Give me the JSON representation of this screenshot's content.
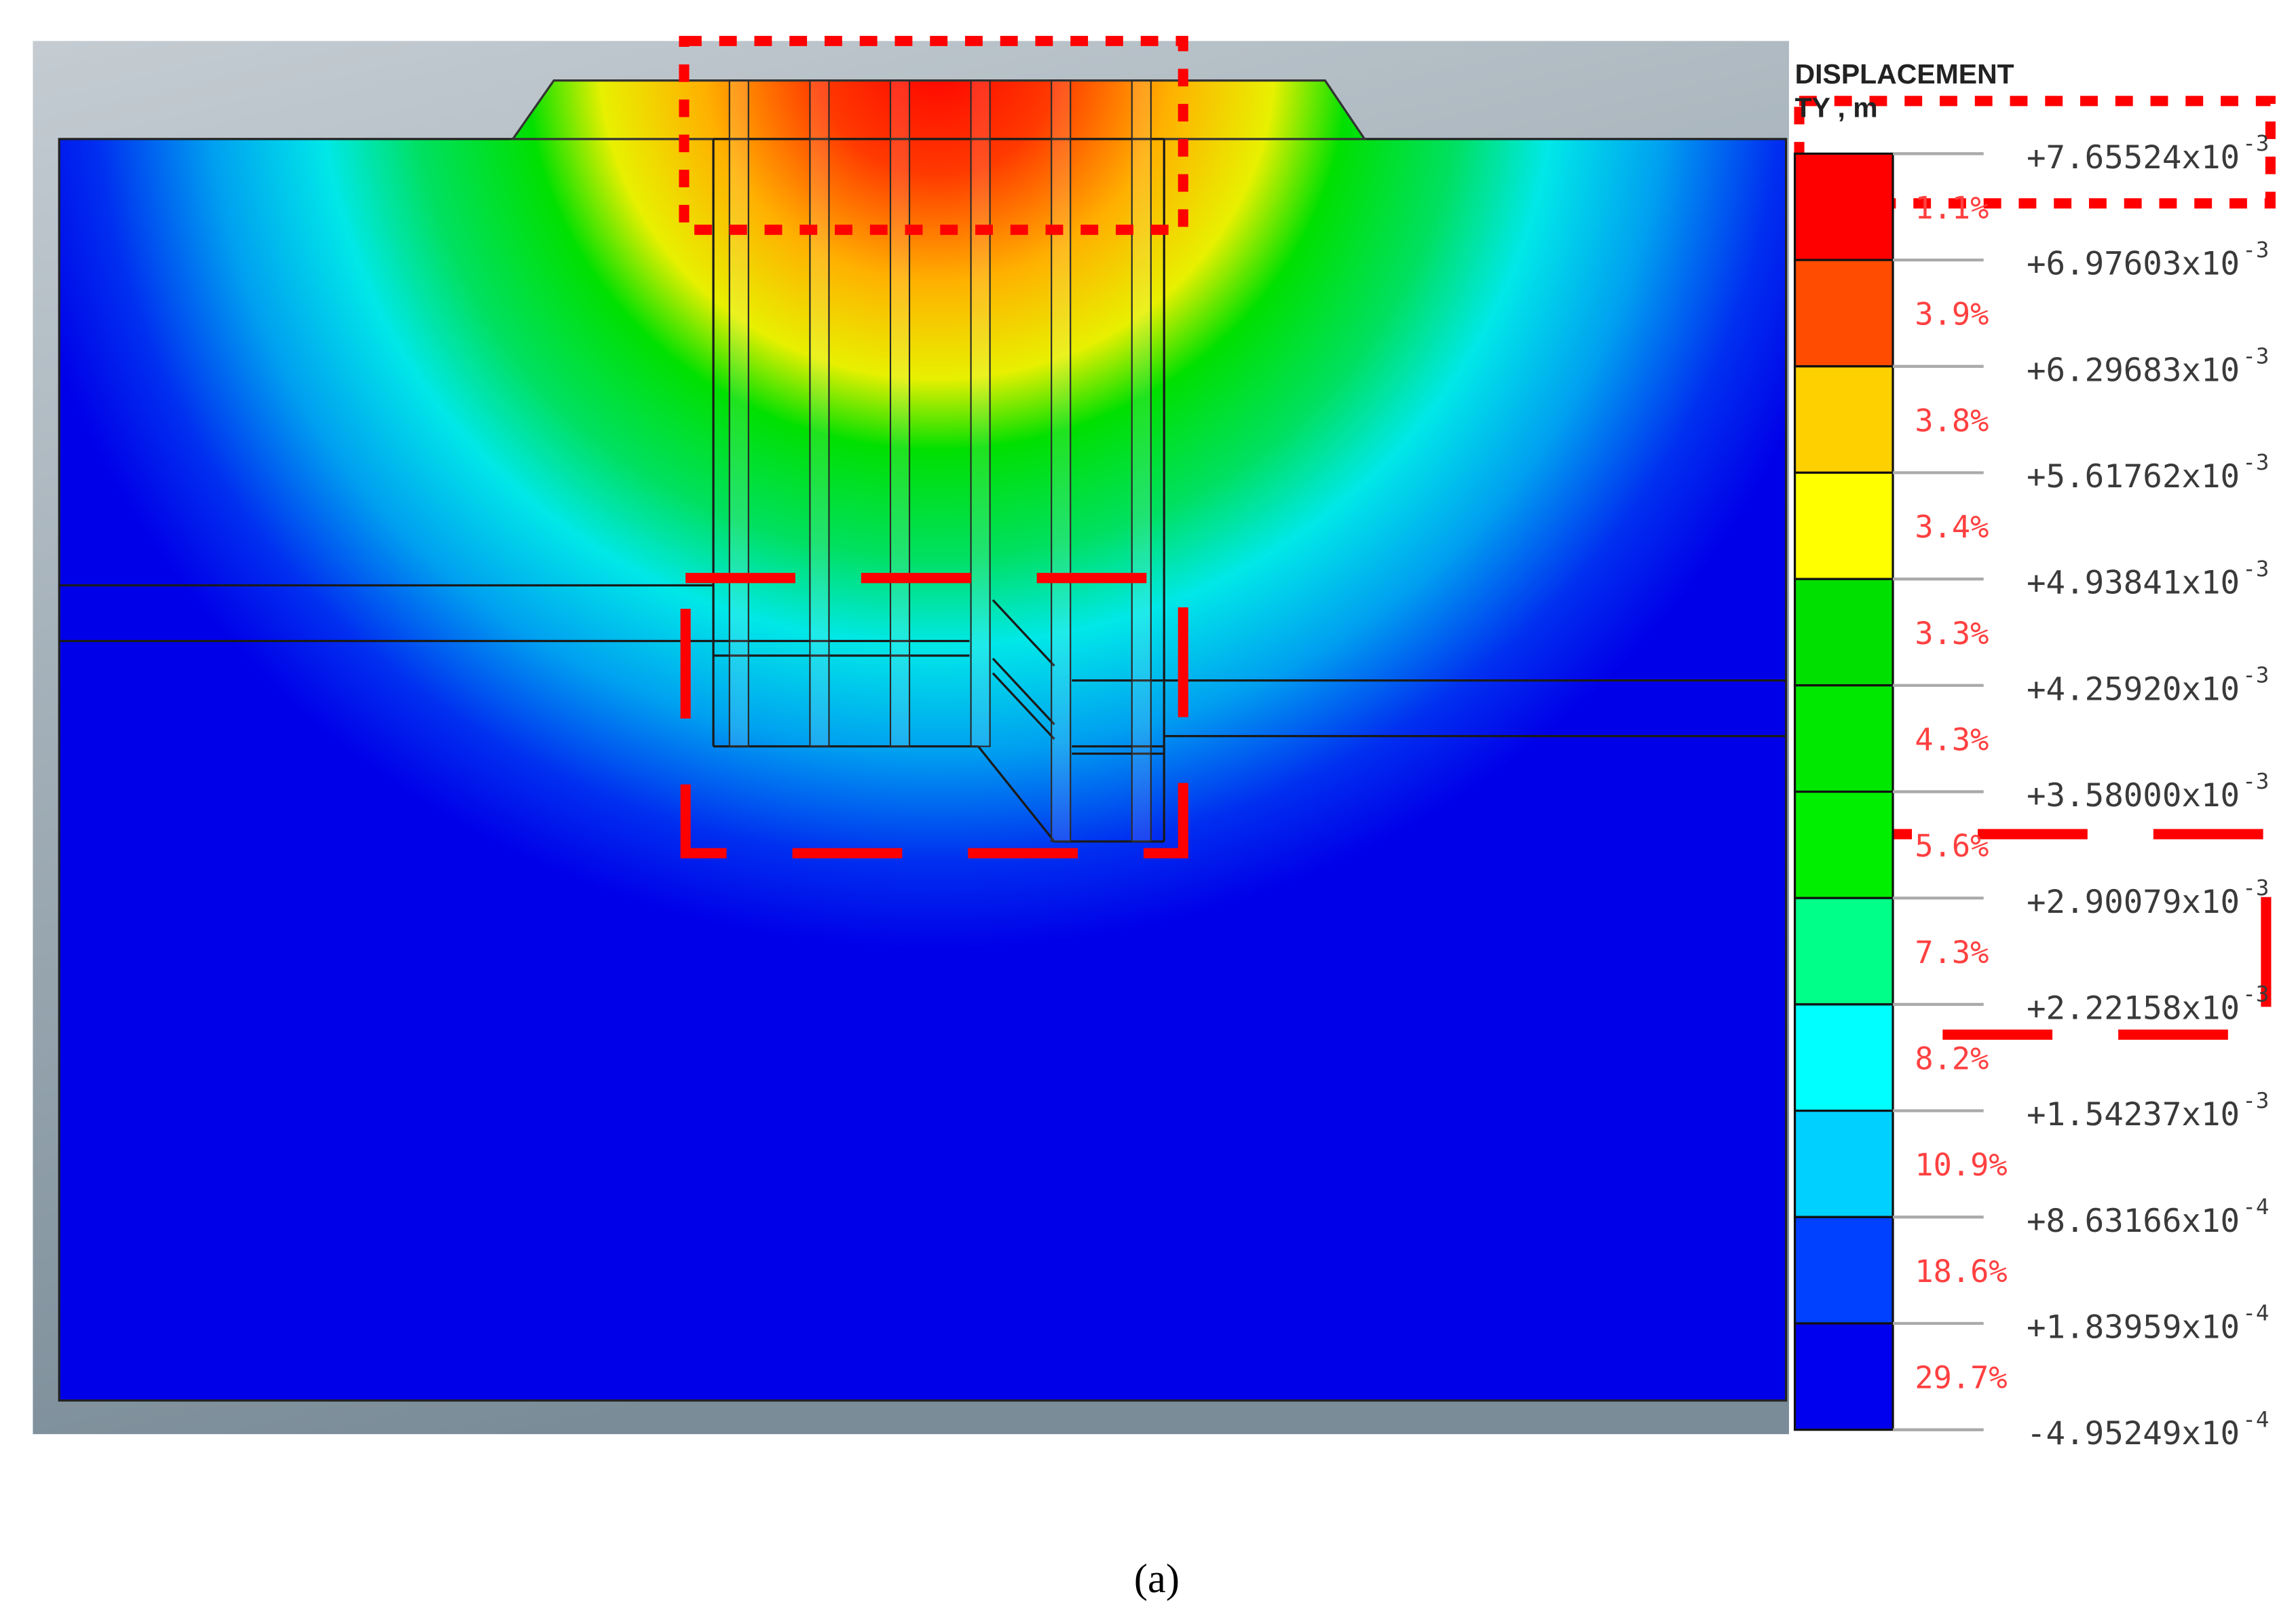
{
  "legend": {
    "title": "DISPLACEMENT",
    "units": "TY , m",
    "colors": [
      "#ff0000",
      "#ff4c00",
      "#ffd000",
      "#ffff00",
      "#00e000",
      "#00e800",
      "#00ee00",
      "#00ff88",
      "#00ffff",
      "#00d0ff",
      "#0040ff",
      "#0000ee"
    ],
    "percentages": [
      "1.1%",
      "3.9%",
      "3.8%",
      "3.4%",
      "3.3%",
      "4.3%",
      "5.6%",
      "7.3%",
      "8.2%",
      "10.9%",
      "18.6%",
      "29.7%"
    ],
    "values": [
      {
        "mantissa": "+7.65524x10",
        "exp": "-3"
      },
      {
        "mantissa": "+6.97603x10",
        "exp": "-3"
      },
      {
        "mantissa": "+6.29683x10",
        "exp": "-3"
      },
      {
        "mantissa": "+5.61762x10",
        "exp": "-3"
      },
      {
        "mantissa": "+4.93841x10",
        "exp": "-3"
      },
      {
        "mantissa": "+4.25920x10",
        "exp": "-3"
      },
      {
        "mantissa": "+3.58000x10",
        "exp": "-3"
      },
      {
        "mantissa": "+2.90079x10",
        "exp": "-3"
      },
      {
        "mantissa": "+2.22158x10",
        "exp": "-3"
      },
      {
        "mantissa": "+1.54237x10",
        "exp": "-3"
      },
      {
        "mantissa": "+8.63166x10",
        "exp": "-4"
      },
      {
        "mantissa": "+1.83959x10",
        "exp": "-4"
      },
      {
        "mantissa": "-4.95249x10",
        "exp": "-4"
      }
    ]
  },
  "caption": "(a)",
  "highlight_color": "#ff0000"
}
